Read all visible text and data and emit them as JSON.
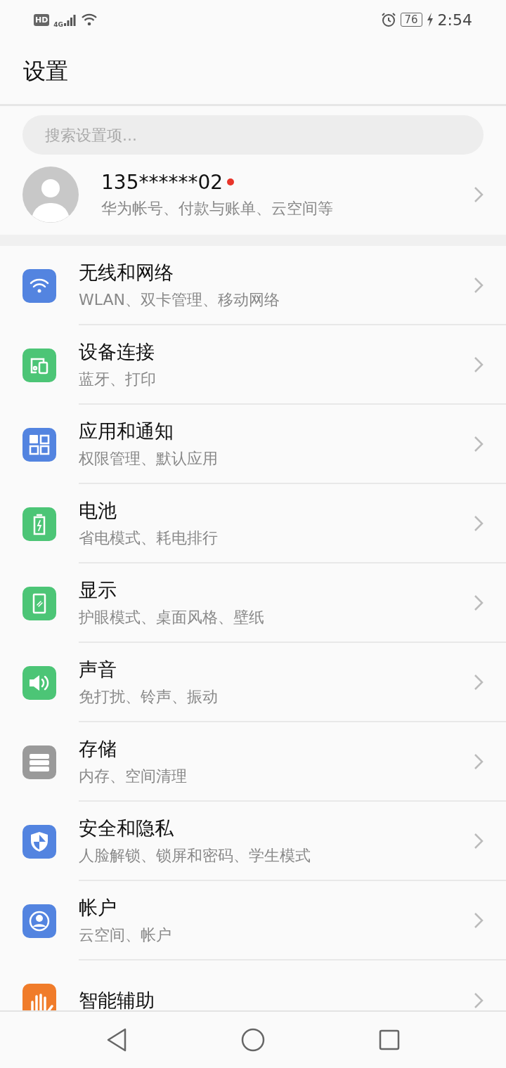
{
  "status_bar": {
    "hd": "HD",
    "network": "4G",
    "battery": "76",
    "time": "2:54"
  },
  "title": "设置",
  "search": {
    "placeholder": "搜索设置项..."
  },
  "account": {
    "name": "135******02",
    "unread": true,
    "subtitle": "华为帐号、付款与账单、云空间等"
  },
  "items": [
    {
      "kind": "wifi",
      "color": "#5384e0",
      "title": "无线和网络",
      "subtitle": "WLAN、双卡管理、移动网络"
    },
    {
      "kind": "devices",
      "color": "#4cc576",
      "title": "设备连接",
      "subtitle": "蓝牙、打印"
    },
    {
      "kind": "apps",
      "color": "#5384e0",
      "title": "应用和通知",
      "subtitle": "权限管理、默认应用"
    },
    {
      "kind": "battery",
      "color": "#4cc576",
      "title": "电池",
      "subtitle": "省电模式、耗电排行"
    },
    {
      "kind": "display",
      "color": "#4cc576",
      "title": "显示",
      "subtitle": "护眼模式、桌面风格、壁纸"
    },
    {
      "kind": "sound",
      "color": "#4cc576",
      "title": "声音",
      "subtitle": "免打扰、铃声、振动"
    },
    {
      "kind": "storage",
      "color": "#9a9a9a",
      "title": "存储",
      "subtitle": "内存、空间清理"
    },
    {
      "kind": "shield",
      "color": "#5384e0",
      "title": "安全和隐私",
      "subtitle": "人脸解锁、锁屏和密码、学生模式"
    },
    {
      "kind": "account",
      "color": "#5384e0",
      "title": "帐户",
      "subtitle": "云空间、帐户"
    },
    {
      "kind": "hand",
      "color": "#f07c2a",
      "title": "智能辅助"
    }
  ]
}
